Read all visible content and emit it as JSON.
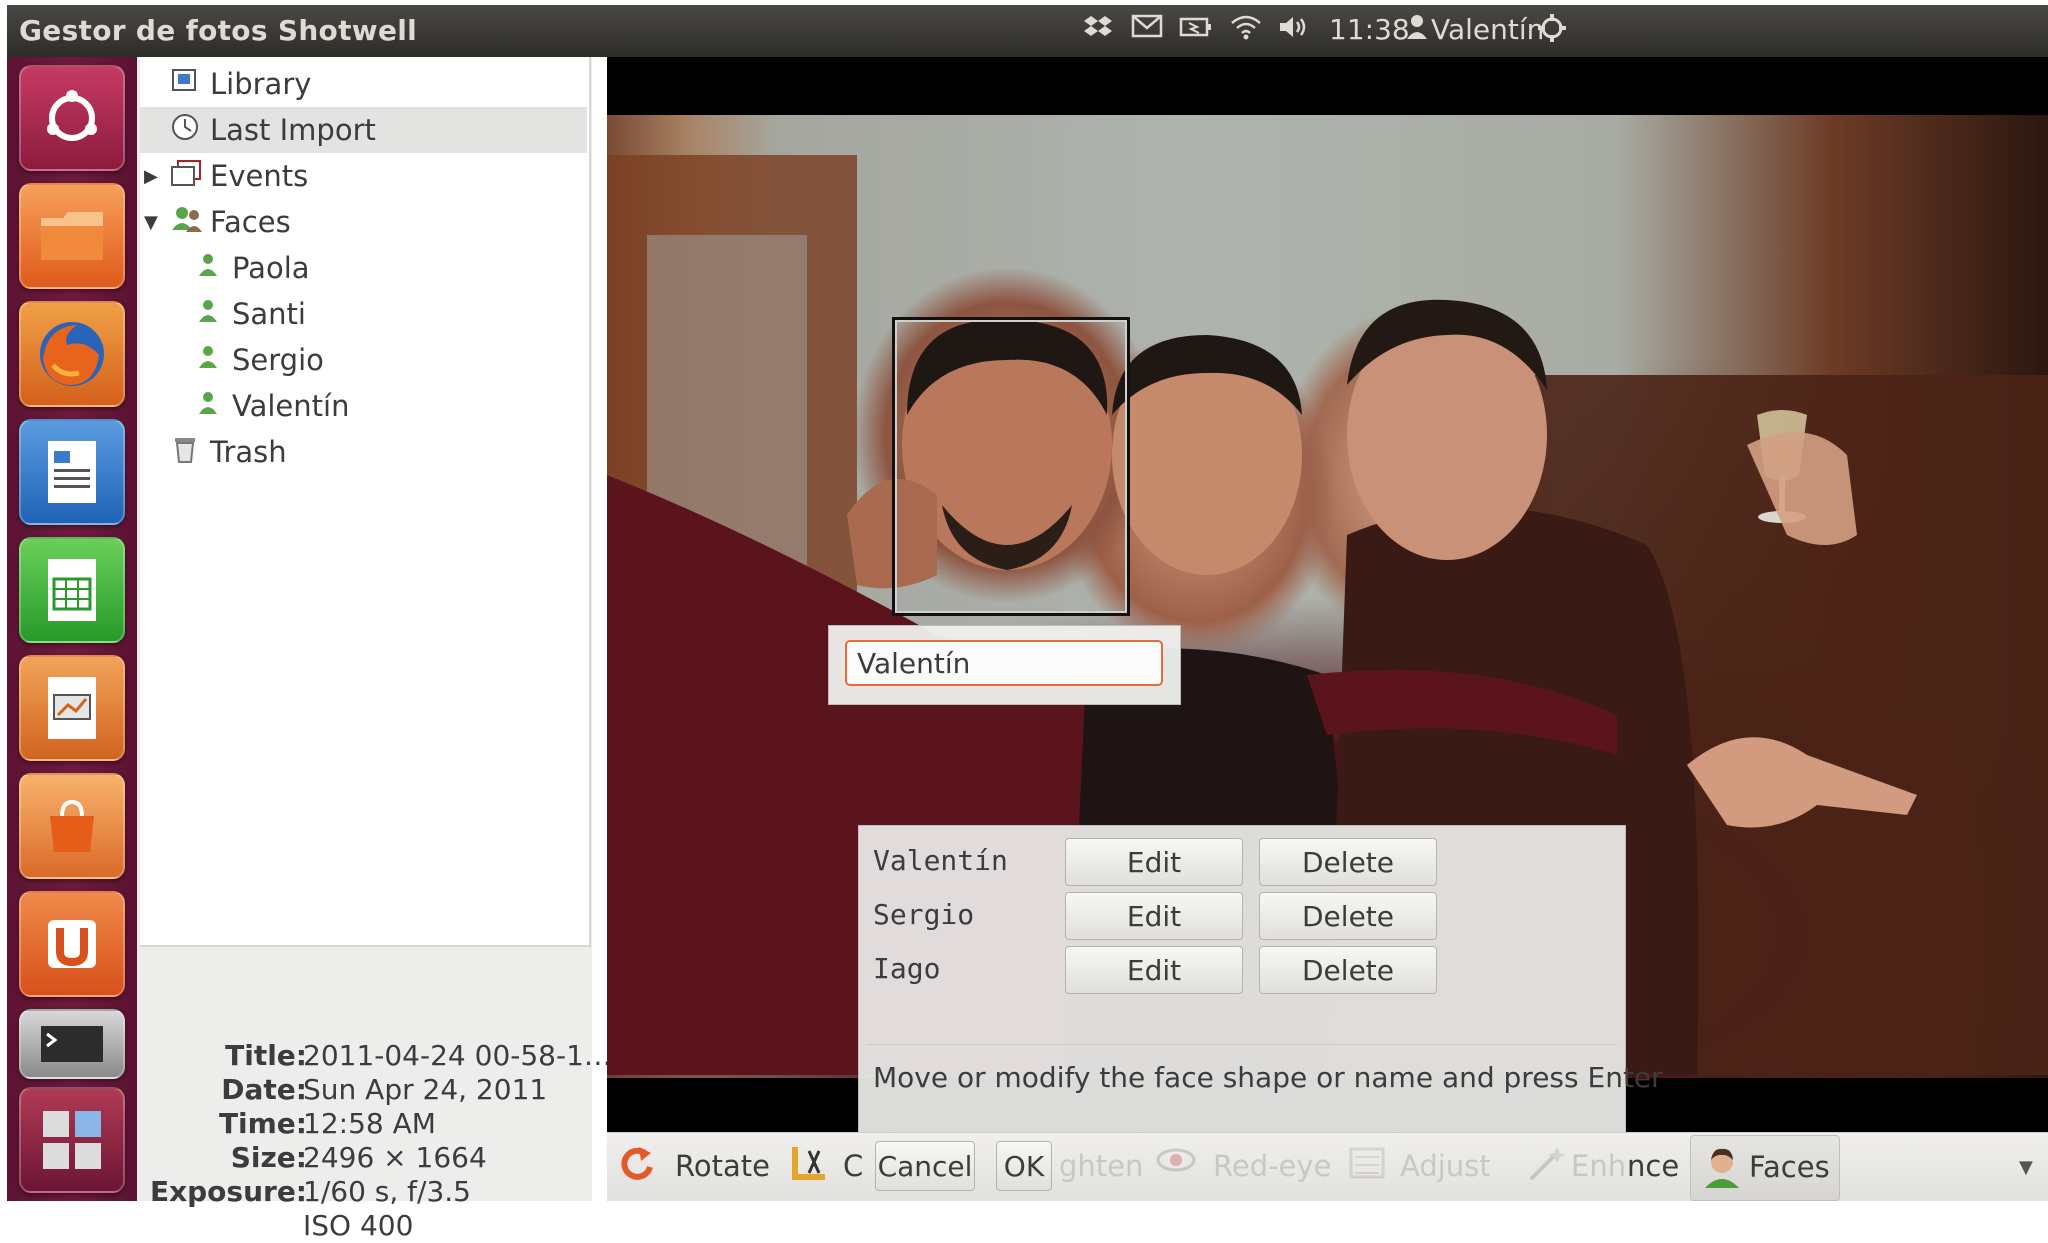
{
  "panel": {
    "window_title": "Gestor de fotos Shotwell",
    "clock": "11:38",
    "user": "Valentín",
    "tray_icons": [
      "dropbox-icon",
      "mail-icon",
      "battery-icon",
      "wifi-icon",
      "volume-icon",
      "user-icon",
      "power-icon"
    ]
  },
  "launcher": {
    "items": [
      "ubuntu-logo-icon",
      "files-icon",
      "firefox-icon",
      "writer-icon",
      "calc-icon",
      "impress-icon",
      "software-center-icon",
      "ubuntu-one-icon",
      "terminal-icon",
      "workspace-switcher-icon"
    ]
  },
  "sidebar": {
    "items": [
      {
        "label": "Library"
      },
      {
        "label": "Last Import"
      },
      {
        "label": "Events"
      },
      {
        "label": "Faces"
      },
      {
        "label": "Paola"
      },
      {
        "label": "Santi"
      },
      {
        "label": "Sergio"
      },
      {
        "label": "Valentín"
      },
      {
        "label": "Trash"
      }
    ]
  },
  "info": {
    "title_key": "Title:",
    "title_val": "2011-04-24 00-58-1…",
    "date_key": "Date:",
    "date_val": "Sun Apr 24, 2011",
    "time_key": "Time:",
    "time_val": "12:58 AM",
    "size_key": "Size:",
    "size_val": "2496 × 1664",
    "exposure_key": "Exposure:",
    "exposure_val": "1/60 s, f/3.5",
    "iso_val": "ISO 400"
  },
  "viewer": {
    "face_name_value": "Valentín",
    "faces": [
      {
        "name": "Valentín",
        "edit": "Edit",
        "delete": "Delete"
      },
      {
        "name": "Sergio",
        "edit": "Edit",
        "delete": "Delete"
      },
      {
        "name": "Iago",
        "edit": "Edit",
        "delete": "Delete"
      }
    ],
    "hint": "Move or modify the face shape or name and press Enter"
  },
  "toolbar": {
    "rotate": "Rotate",
    "crop_partial": "C",
    "cancel": "Cancel",
    "ok": "OK",
    "straighten_partial": "ghten",
    "redeye": "Red-eye",
    "adjust": "Adjust",
    "enhance_partial_1": "Enh",
    "enhance_partial_2": "nce",
    "faces": "Faces"
  }
}
